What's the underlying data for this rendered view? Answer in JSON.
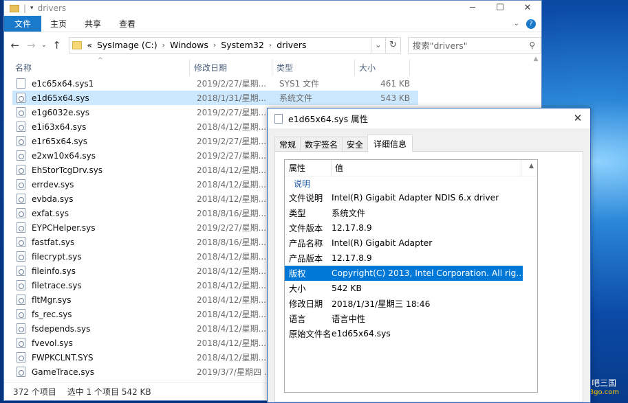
{
  "explorer": {
    "title": "drivers",
    "title_sep": "|",
    "window_controls": [
      "─",
      "☐",
      "✕"
    ],
    "ribbon": {
      "file": "文件",
      "tabs": [
        "主页",
        "共享",
        "查看"
      ]
    },
    "address": {
      "prefix": "«",
      "crumbs": [
        "SysImage (C:)",
        "Windows",
        "System32",
        "drivers"
      ],
      "search_placeholder": "搜索\"drivers\""
    },
    "columns": {
      "name": "名称",
      "date": "修改日期",
      "type": "类型",
      "size": "大小"
    },
    "files": [
      {
        "name": "e1c65x64.sys1",
        "date": "2019/2/27/星期...",
        "type": "SYS1 文件",
        "size": "461 KB",
        "gear": false
      },
      {
        "name": "e1d65x64.sys",
        "date": "2018/1/31/星期...",
        "type": "系统文件",
        "size": "543 KB",
        "gear": true,
        "selected": true
      },
      {
        "name": "e1g6032e.sys",
        "date": "2019/2/27/星期...",
        "type": "",
        "size": "",
        "gear": true
      },
      {
        "name": "e1i63x64.sys",
        "date": "2018/4/12/星期...",
        "type": "",
        "size": "",
        "gear": true
      },
      {
        "name": "e1r65x64.sys",
        "date": "2019/2/27/星期...",
        "type": "",
        "size": "",
        "gear": true
      },
      {
        "name": "e2xw10x64.sys",
        "date": "2019/2/27/星期...",
        "type": "",
        "size": "",
        "gear": true
      },
      {
        "name": "EhStorTcgDrv.sys",
        "date": "2018/4/12/星期...",
        "type": "",
        "size": "",
        "gear": true
      },
      {
        "name": "errdev.sys",
        "date": "2018/4/12/星期...",
        "type": "",
        "size": "",
        "gear": true
      },
      {
        "name": "evbda.sys",
        "date": "2018/4/12/星期...",
        "type": "",
        "size": "",
        "gear": true
      },
      {
        "name": "exfat.sys",
        "date": "2018/8/16/星期...",
        "type": "",
        "size": "",
        "gear": true
      },
      {
        "name": "EYPCHelper.sys",
        "date": "2019/2/27/星期...",
        "type": "",
        "size": "",
        "gear": true
      },
      {
        "name": "fastfat.sys",
        "date": "2018/8/16/星期...",
        "type": "",
        "size": "",
        "gear": true
      },
      {
        "name": "filecrypt.sys",
        "date": "2018/4/12/星期...",
        "type": "",
        "size": "",
        "gear": true
      },
      {
        "name": "fileinfo.sys",
        "date": "2018/4/12/星期...",
        "type": "",
        "size": "",
        "gear": true
      },
      {
        "name": "filetrace.sys",
        "date": "2018/4/12/星期...",
        "type": "",
        "size": "",
        "gear": true
      },
      {
        "name": "fltMgr.sys",
        "date": "2018/4/12/星期...",
        "type": "",
        "size": "",
        "gear": true
      },
      {
        "name": "fs_rec.sys",
        "date": "2018/4/12/星期...",
        "type": "",
        "size": "",
        "gear": true
      },
      {
        "name": "fsdepends.sys",
        "date": "2018/4/12/星期...",
        "type": "",
        "size": "",
        "gear": true
      },
      {
        "name": "fvevol.sys",
        "date": "2018/4/12/星期...",
        "type": "",
        "size": "",
        "gear": true
      },
      {
        "name": "FWPKCLNT.SYS",
        "date": "2018/4/12/星期...",
        "type": "",
        "size": "",
        "gear": true
      },
      {
        "name": "GameTrace.sys",
        "date": "2019/3/7/星期四 ...",
        "type": "",
        "size": "",
        "gear": true
      }
    ],
    "status": {
      "count": "372 个项目",
      "selected": "选中 1 个项目  542 KB"
    }
  },
  "props": {
    "title": "e1d65x64.sys 属性",
    "close": "✕",
    "tabs": [
      "常规",
      "数字签名",
      "安全",
      "详细信息"
    ],
    "active_tab": 3,
    "header": {
      "key": "属性",
      "value": "值"
    },
    "group": "说明",
    "rows": [
      {
        "k": "文件说明",
        "v": "Intel(R) Gigabit Adapter NDIS 6.x driver"
      },
      {
        "k": "类型",
        "v": "系统文件"
      },
      {
        "k": "文件版本",
        "v": "12.17.8.9"
      },
      {
        "k": "产品名称",
        "v": "Intel(R) Gigabit Adapter"
      },
      {
        "k": "产品版本",
        "v": "12.17.8.9"
      },
      {
        "k": "版权",
        "v": "Copyright(C) 2013, Intel Corporation.  All rig...",
        "selected": true
      },
      {
        "k": "大小",
        "v": "542 KB"
      },
      {
        "k": "修改日期",
        "v": "2018/1/31/星期三 18:46"
      },
      {
        "k": "语言",
        "v": "语言中性"
      },
      {
        "k": "原始文件名",
        "v": "e1d65x64.sys"
      }
    ]
  },
  "watermark": {
    "main": "网吧三国",
    "sub": "583go.com"
  },
  "colors": {
    "accent": "#0078d7",
    "file_tab": "#1979ca",
    "selection": "#cce8ff"
  }
}
